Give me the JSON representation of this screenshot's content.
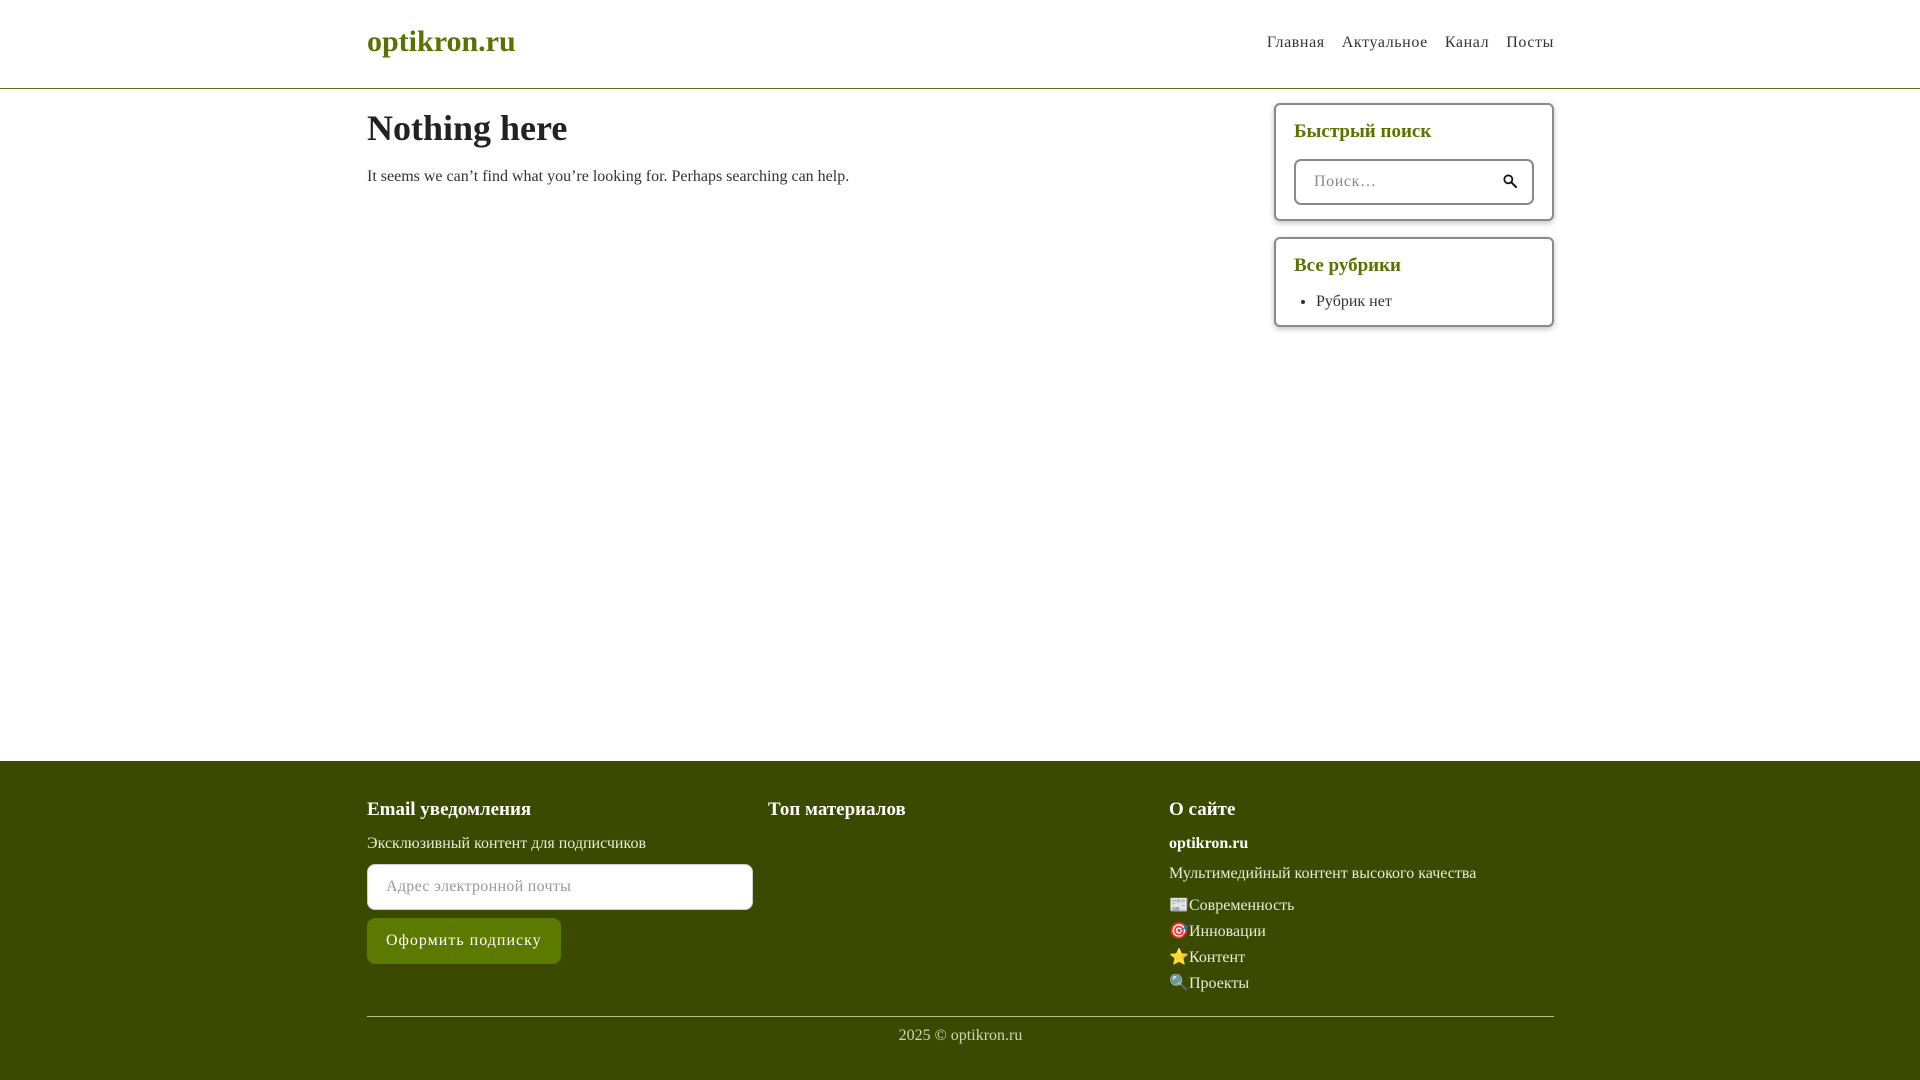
{
  "header": {
    "logo": "optikron.ru",
    "nav": [
      "Главная",
      "Актуальное",
      "Канал",
      "Посты"
    ]
  },
  "main": {
    "title": "Nothing here",
    "message": "It seems we can’t find what you’re looking for. Perhaps searching can help."
  },
  "sidebar": {
    "search_widget": {
      "title": "Быстрый поиск",
      "placeholder": "Поиск…"
    },
    "categories_widget": {
      "title": "Все рубрики",
      "items": [
        "Рубрик нет"
      ]
    }
  },
  "footer": {
    "email": {
      "title": "Email уведомления",
      "text": "Эксклюзивный контент для подписчиков",
      "placeholder": "Адрес электронной почты",
      "button": "Оформить подписку"
    },
    "top": {
      "title": "Топ материалов"
    },
    "about": {
      "title": "О сайте",
      "site_name": "optikron.ru",
      "description": "Мультимедийный контент высокого качества",
      "links": [
        {
          "emoji": "📰",
          "label": "Современность"
        },
        {
          "emoji": "🎯",
          "label": "Инновации"
        },
        {
          "emoji": "⭐",
          "label": "Контент"
        },
        {
          "emoji": "🔍",
          "label": "Проекты"
        }
      ]
    },
    "copyright": "2025 © optikron.ru"
  },
  "colors": {
    "brand": "#5a7200",
    "footer_bg": "#3a4a00",
    "button_bg": "#5c7a00"
  }
}
